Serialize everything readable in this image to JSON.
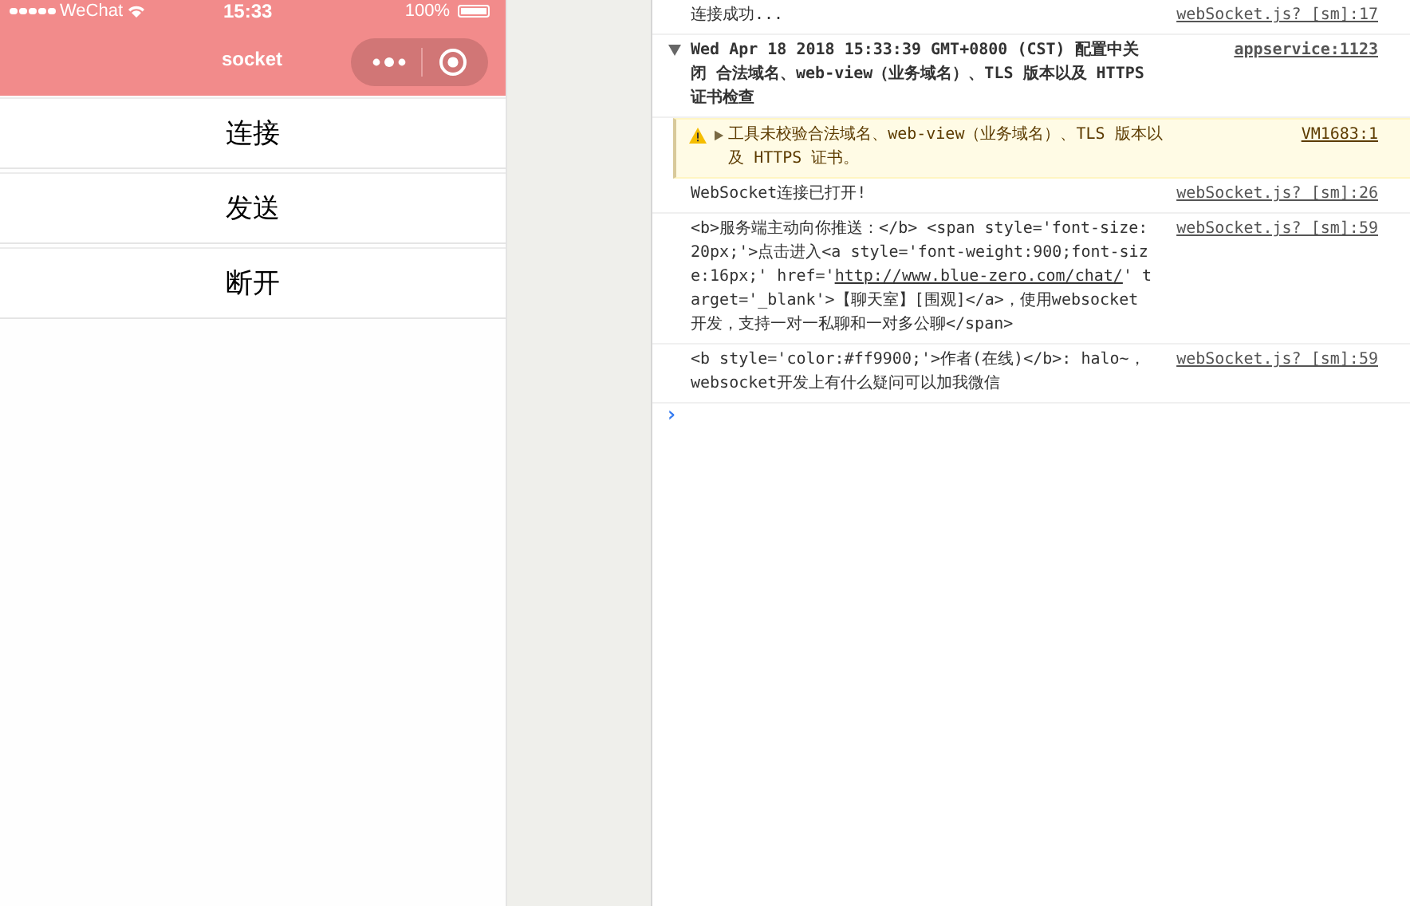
{
  "status_bar": {
    "carrier": "WeChat",
    "time": "15:33",
    "battery": "100%"
  },
  "nav_bar": {
    "title": "socket"
  },
  "buttons": [
    "连接",
    "发送",
    "断开"
  ],
  "console": {
    "entries": [
      {
        "kind": "log",
        "text": "连接成功...",
        "source": "webSocket.js? [sm]:17"
      },
      {
        "kind": "group",
        "expanded": true,
        "text": "Wed Apr 18 2018 15:33:39 GMT+0800 (CST) 配置中关闭 合法域名、web-view（业务域名）、TLS 版本以及 HTTPS 证书检查",
        "source": "appservice:1123"
      },
      {
        "kind": "warning",
        "expanded": false,
        "text": "工具未校验合法域名、web-view（业务域名）、TLS 版本以及 HTTPS 证书。",
        "source": "VM1683:1"
      },
      {
        "kind": "log",
        "text": "WebSocket连接已打开!",
        "source": "webSocket.js? [sm]:26"
      },
      {
        "kind": "log",
        "text": "<b>服务端主动向你推送：</b> <span style='font-size:20px;'>点击进入<a style='font-weight:900;font-size:16px;' href='",
        "link": "http://www.blue-zero.com/chat/",
        "text_after": "' target='_blank'>【聊天室】[围观]</a>，使用websocket开发，支持一对一私聊和一对多公聊</span>",
        "source": "webSocket.js? [sm]:59"
      },
      {
        "kind": "log",
        "text": "<b style='color:#ff9900;'>作者(在线)</b>: halo~，websocket开发上有什么疑问可以加我微信",
        "source": "webSocket.js? [sm]:59"
      }
    ],
    "prompt": "›"
  }
}
